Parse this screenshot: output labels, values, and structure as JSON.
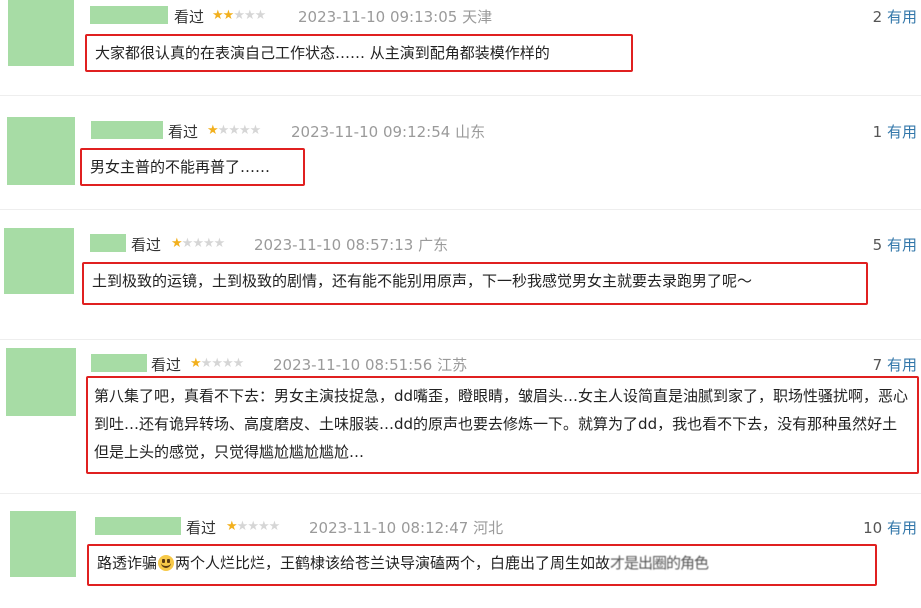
{
  "comments": [
    {
      "watched": "看过",
      "stars_filled": 2,
      "stars_total": 5,
      "time": "2023-11-10 09:13:05",
      "location": "天津",
      "useful_count": "2",
      "useful_label": "有用",
      "content": "大家都很认真的在表演自己工作状态…… 从主演到配角都装模作样的"
    },
    {
      "watched": "看过",
      "stars_filled": 1,
      "stars_total": 5,
      "time": "2023-11-10 09:12:54",
      "location": "山东",
      "useful_count": "1",
      "useful_label": "有用",
      "content": "男女主普的不能再普了……"
    },
    {
      "watched": "看过",
      "stars_filled": 1,
      "stars_total": 5,
      "time": "2023-11-10 08:57:13",
      "location": "广东",
      "useful_count": "5",
      "useful_label": "有用",
      "content": "土到极致的运镜，土到极致的剧情，还有能不能别用原声，下一秒我感觉男女主就要去录跑男了呢～"
    },
    {
      "watched": "看过",
      "stars_filled": 1,
      "stars_total": 5,
      "time": "2023-11-10 08:51:56",
      "location": "江苏",
      "useful_count": "7",
      "useful_label": "有用",
      "content": "第八集了吧，真看不下去：男女主演技捉急，dd嘴歪，瞪眼睛，皱眉头…女主人设简直是油腻到家了，职场性骚扰啊，恶心到吐…还有诡异转场、高度磨皮、土味服装…dd的原声也要去修炼一下。就算为了dd，我也看不下去，没有那种虽然好土但是上头的感觉，只觉得尴尬尴尬尴尬…"
    },
    {
      "watched": "看过",
      "stars_filled": 1,
      "stars_total": 5,
      "time": "2023-11-10 08:12:47",
      "location": "河北",
      "useful_count": "10",
      "useful_label": "有用",
      "content_a": "路透诈骗",
      "content_b": "两个人烂比烂，王鹤棣该给苍兰诀导演磕两个，白鹿出了周生如故",
      "content_c": "才是出圈的角色"
    }
  ],
  "colors": {
    "avatar": "#a7dca5",
    "star_on": "#f2b01e",
    "star_off": "#d6d6d6",
    "highlight_border": "#e02020",
    "useful_label": "#3377aa",
    "meta": "#9a9a9a"
  },
  "icons": {
    "star_filled": "star-filled-icon",
    "star_empty": "star-empty-icon",
    "emoji": "grinning-face-icon"
  }
}
